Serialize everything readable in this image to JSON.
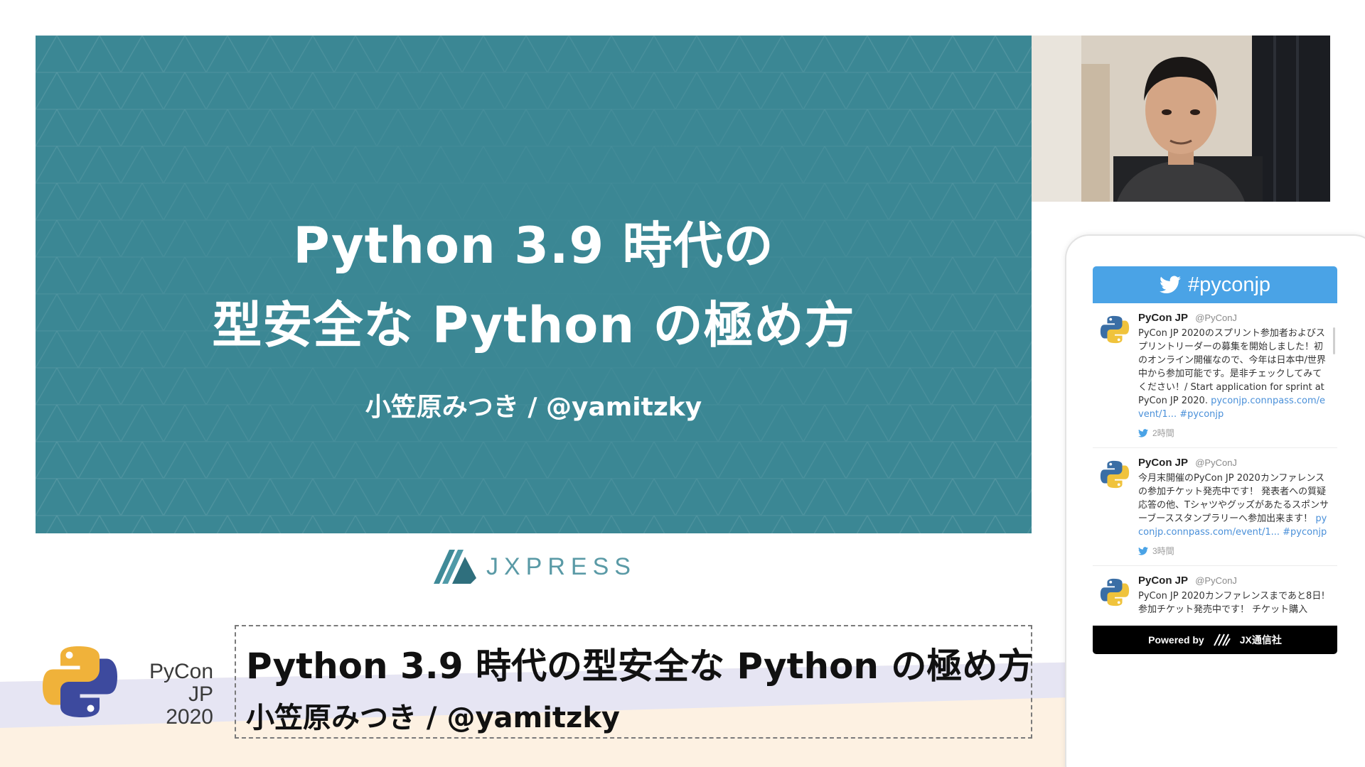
{
  "slide": {
    "title_line1": "Python 3.9 時代の",
    "title_line2": "型安全な Python の極め方",
    "author": "小笠原みつき / @yamitzky",
    "background_color": "#3b8794"
  },
  "sponsor": {
    "name": "JXPRESS"
  },
  "conference": {
    "name_line1": "PyCon JP",
    "name_line2": "2020"
  },
  "lower_third": {
    "title": "Python 3.9 時代の型安全な Python の極め方",
    "author": "小笠原みつき / @yamitzky"
  },
  "twitter_widget": {
    "hashtag": "#pyconjp",
    "header_icon": "twitter-bird-icon",
    "accent_color": "#4aa3e6",
    "tweets": [
      {
        "name": "PyCon JP",
        "handle": "@PyConJ",
        "text": "PyCon JP 2020のスプリント参加者およびスプリントリーダーの募集を開始しました！初のオンライン開催なので、今年は日本中/世界中から参加可能です。是非チェックしてみてください！/ Start application for sprint at PyCon JP 2020.",
        "link": "pyconjp.connpass.com/event/1... #pyconjp",
        "time": "2時間"
      },
      {
        "name": "PyCon JP",
        "handle": "@PyConJ",
        "text": "今月末開催のPyCon JP 2020カンファレンスの参加チケット発売中です！ 発表者への質疑応答の他、Tシャツやグッズがあたるスポンサーブーススタンプラリーへ参加出来ます！",
        "link": "pyconjp.connpass.com/event/1... #pyconjp",
        "time": "3時間"
      },
      {
        "name": "PyCon JP",
        "handle": "@PyConJ",
        "text": "PyCon JP 2020カンファレンスまであと8日! 参加チケット発売中です！ チケット購入",
        "link": "",
        "time": ""
      }
    ],
    "footer_label": "Powered by",
    "footer_brand": "JX通信社"
  }
}
